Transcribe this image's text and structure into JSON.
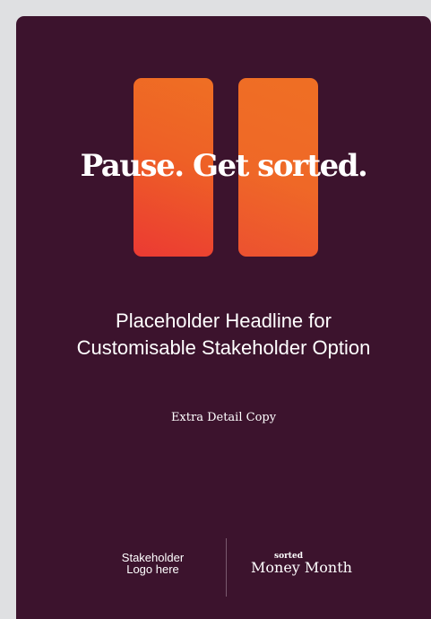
{
  "poster": {
    "tagline": "Pause. Get sorted.",
    "headline_line1": "Placeholder Headline for",
    "headline_line2": "Customisable Stakeholder Option",
    "detail": "Extra Detail Copy",
    "stakeholder_line1": "Stakeholder",
    "stakeholder_line2": "Logo here",
    "brand_small": "sorted",
    "brand_big": "Money Month"
  },
  "colors": {
    "background": "#3c132d",
    "accent_orange": "#ef6f24",
    "accent_red": "#eb3a33",
    "page_bg": "#dfe0e2"
  },
  "icons": {
    "pause_symbol": "pause-icon"
  }
}
